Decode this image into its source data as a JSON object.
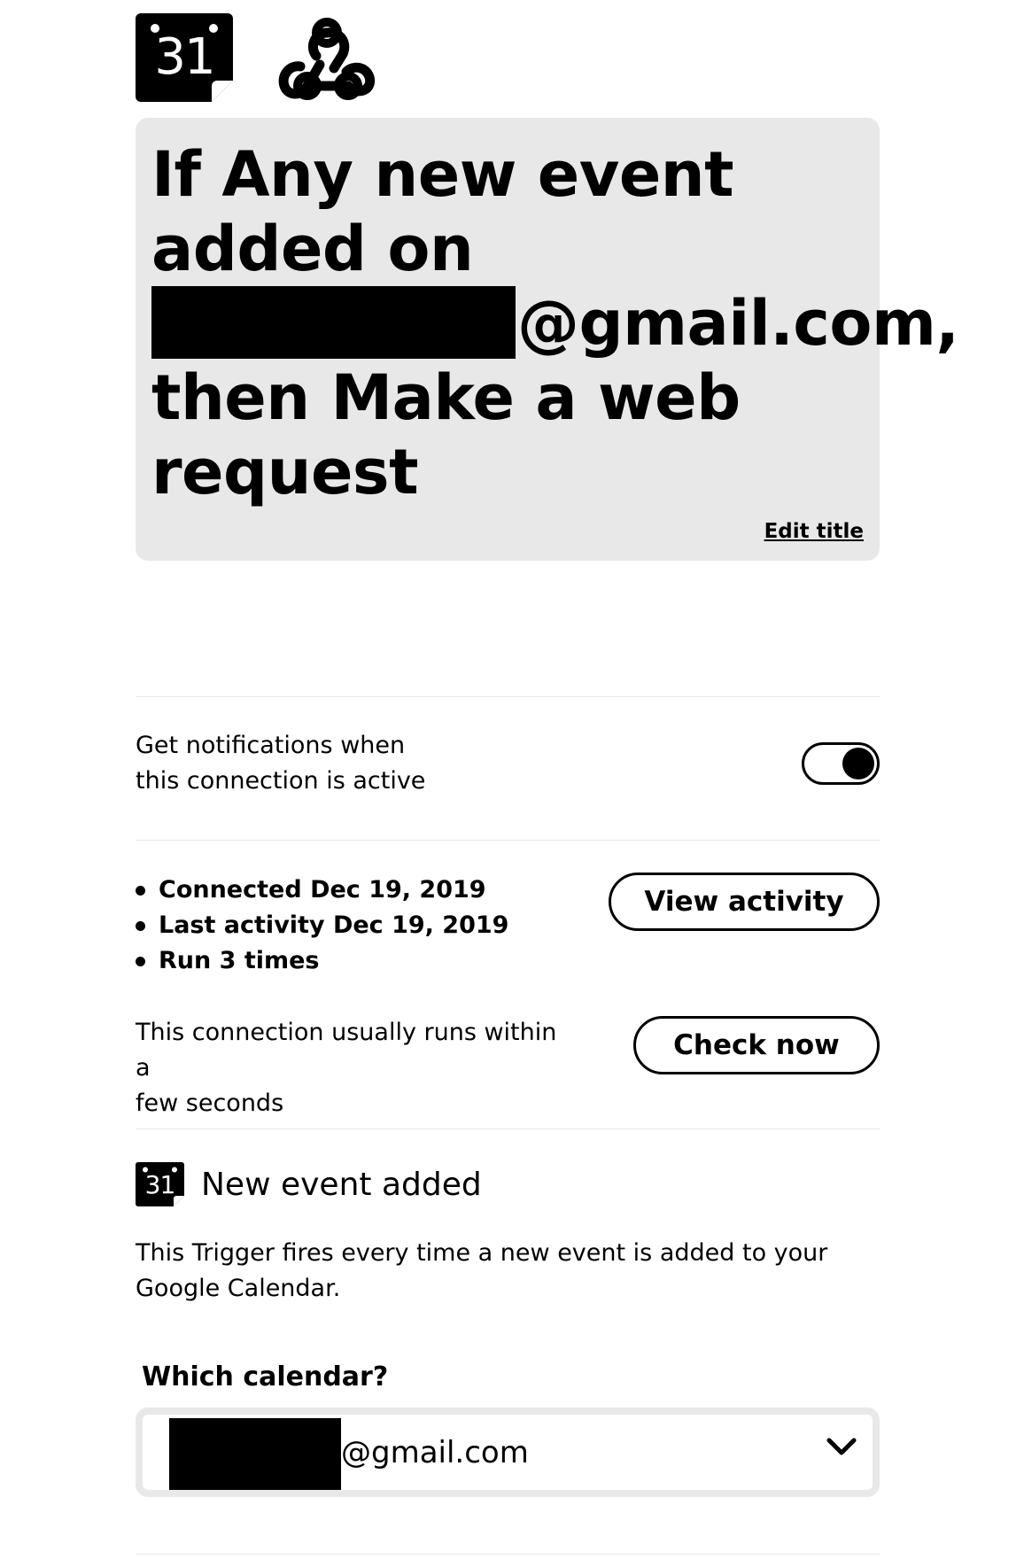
{
  "services": {
    "trigger_icon": "google-calendar-icon",
    "trigger_icon_number": "31",
    "action_icon": "webhook-icon"
  },
  "title_card": {
    "line1": "If Any new event",
    "line2": "added on",
    "email_suffix": "@gmail.com,",
    "line4": "then Make a web",
    "line5": "request",
    "edit_label": "Edit title"
  },
  "notifications": {
    "line1": "Get notifications when",
    "line2": "this connection is active",
    "toggle_on": true
  },
  "stats": {
    "items": [
      "Connected Dec 19, 2019",
      "Last activity Dec 19, 2019",
      "Run 3 times"
    ],
    "view_activity_label": "View activity"
  },
  "runs": {
    "line1": "This connection usually runs within a",
    "line2": "few seconds",
    "check_now_label": "Check now"
  },
  "trigger": {
    "icon": "google-calendar-icon",
    "icon_number": "31",
    "title": "New event added",
    "desc_line1": "This Trigger fires every time a new event is added to your",
    "desc_line2": "Google Calendar."
  },
  "calendar_field": {
    "label": "Which calendar?",
    "value_suffix": "@gmail.com",
    "chevron_icon": "chevron-down-icon"
  },
  "colors": {
    "card_bg": "#e8e8e8",
    "text": "#000000",
    "background": "#ffffff"
  }
}
